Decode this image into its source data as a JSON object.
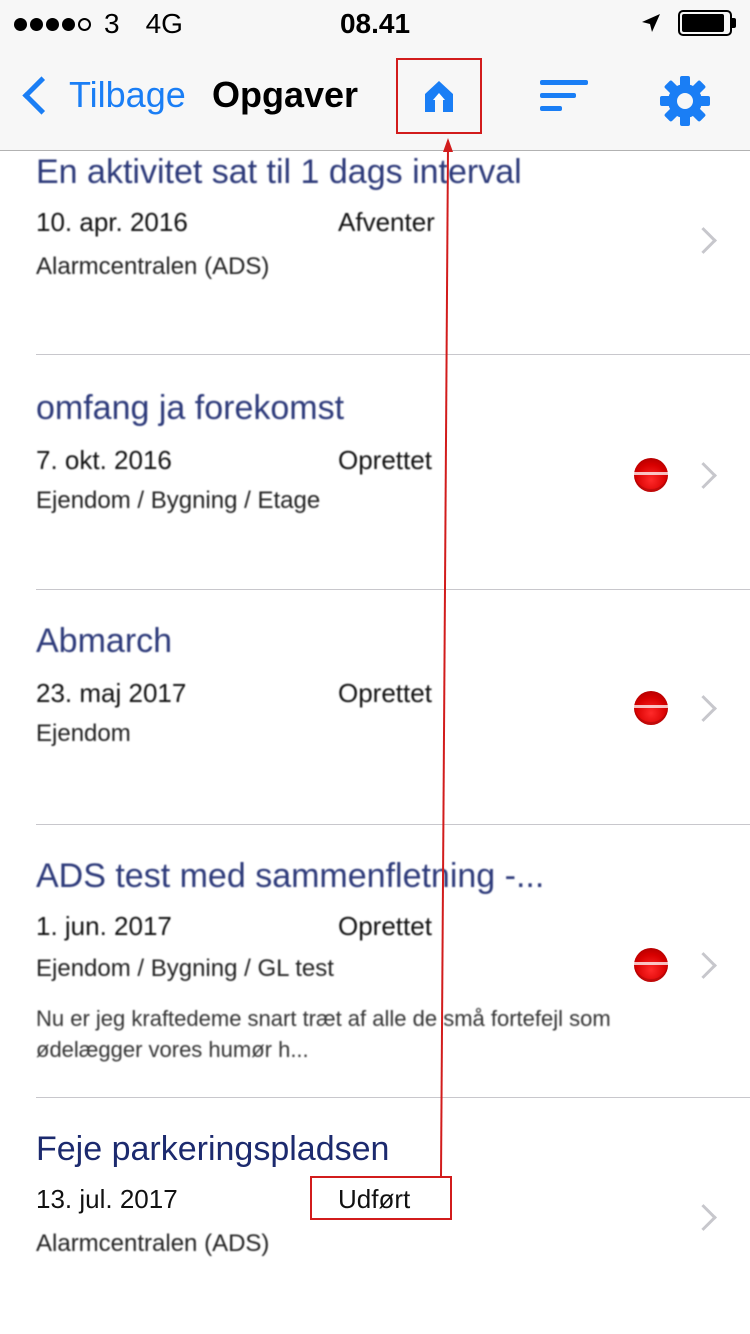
{
  "status_bar": {
    "carrier": "3",
    "network": "4G",
    "time": "08.41"
  },
  "nav": {
    "back_label": "Tilbage",
    "title": "Opgaver",
    "icons": [
      "home-icon",
      "sort-icon",
      "gear-icon"
    ],
    "accent_color": "#1a7ef5"
  },
  "tasks": [
    {
      "title": "En aktivitet sat til 1 dags interval",
      "date": "10. apr. 2016",
      "status": "Afventer",
      "location": "Alarmcentralen (ADS)",
      "description": "",
      "badge": false
    },
    {
      "title": "omfang ja forekomst",
      "date": "7. okt. 2016",
      "status": "Oprettet",
      "location": "Ejendom / Bygning / Etage",
      "description": "",
      "badge": true
    },
    {
      "title": "Abmarch",
      "date": "23. maj 2017",
      "status": "Oprettet",
      "location": "Ejendom",
      "description": "",
      "badge": true
    },
    {
      "title": "ADS test med sammenfletning -...",
      "date": "1. jun. 2017",
      "status": "Oprettet",
      "location": "Ejendom / Bygning / GL test",
      "description": "Nu er jeg kraftedeme snart træt af alle de små fortefejl som ødelægger vores humør h...",
      "badge": true
    },
    {
      "title": "Feje parkeringspladsen",
      "date": "13. jul. 2017",
      "status": "Udført",
      "location": "Alarmcentralen (ADS)",
      "description": "",
      "badge": false
    }
  ],
  "colors": {
    "annotation": "#d21c1c",
    "status_badge": "#d80000",
    "title_text": "#1c2a6e"
  }
}
